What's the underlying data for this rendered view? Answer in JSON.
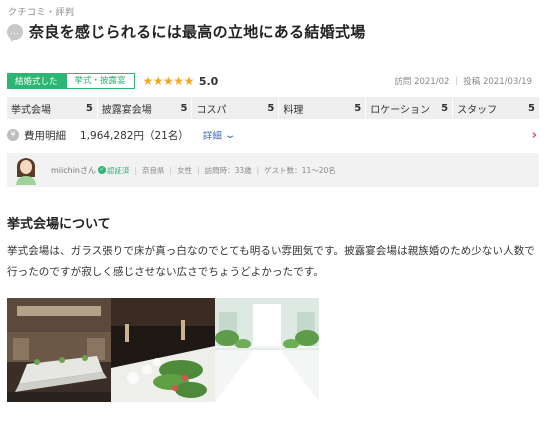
{
  "breadcrumb": "クチコミ・評判",
  "review": {
    "title": "奈良を感じられるには最高の立地にある結婚式場",
    "tags": [
      "結婚式した",
      "挙式・披露宴"
    ],
    "rating": 5.0,
    "rating_text": "5.0",
    "stars": "★★★★★",
    "visit_date": "訪問 2021/02",
    "post_date": "投稿 2021/03/19",
    "dates_text": "訪問 2021/02 ｜ 投稿 2021/03/19"
  },
  "ratings": [
    {
      "label": "挙式会場",
      "value": "5"
    },
    {
      "label": "披露宴会場",
      "value": "5"
    },
    {
      "label": "コスパ",
      "value": "5"
    },
    {
      "label": "料理",
      "value": "5"
    },
    {
      "label": "ロケーション",
      "value": "5"
    },
    {
      "label": "スタッフ",
      "value": "5"
    }
  ],
  "cost": {
    "icon": "yen-icon",
    "label": "費用明細",
    "value": "1,964,282円（21名）",
    "detail_label": "詳細"
  },
  "user": {
    "name": "miichinさん",
    "verified_label": "認証済",
    "prefecture": "奈良県",
    "gender": "女性",
    "visit_time": "訪問時：33歳",
    "guests": "ゲスト数：11〜20名"
  },
  "section": {
    "title": "挙式会場について",
    "body": "挙式会場は、ガラス張りで床が真っ白なのでとても明るい雰囲気です。披露宴会場は親族婚のため少ない人数で行ったのですが寂しく感じさせない広さでちょうどよかったです。"
  },
  "photos": [
    "banquet-hall-photo",
    "table-setting-photo",
    "chapel-photo"
  ],
  "colors": {
    "accent_green": "#2bb673",
    "star": "#f5a623",
    "link": "#3a66b8",
    "chevron": "#e8465a"
  }
}
